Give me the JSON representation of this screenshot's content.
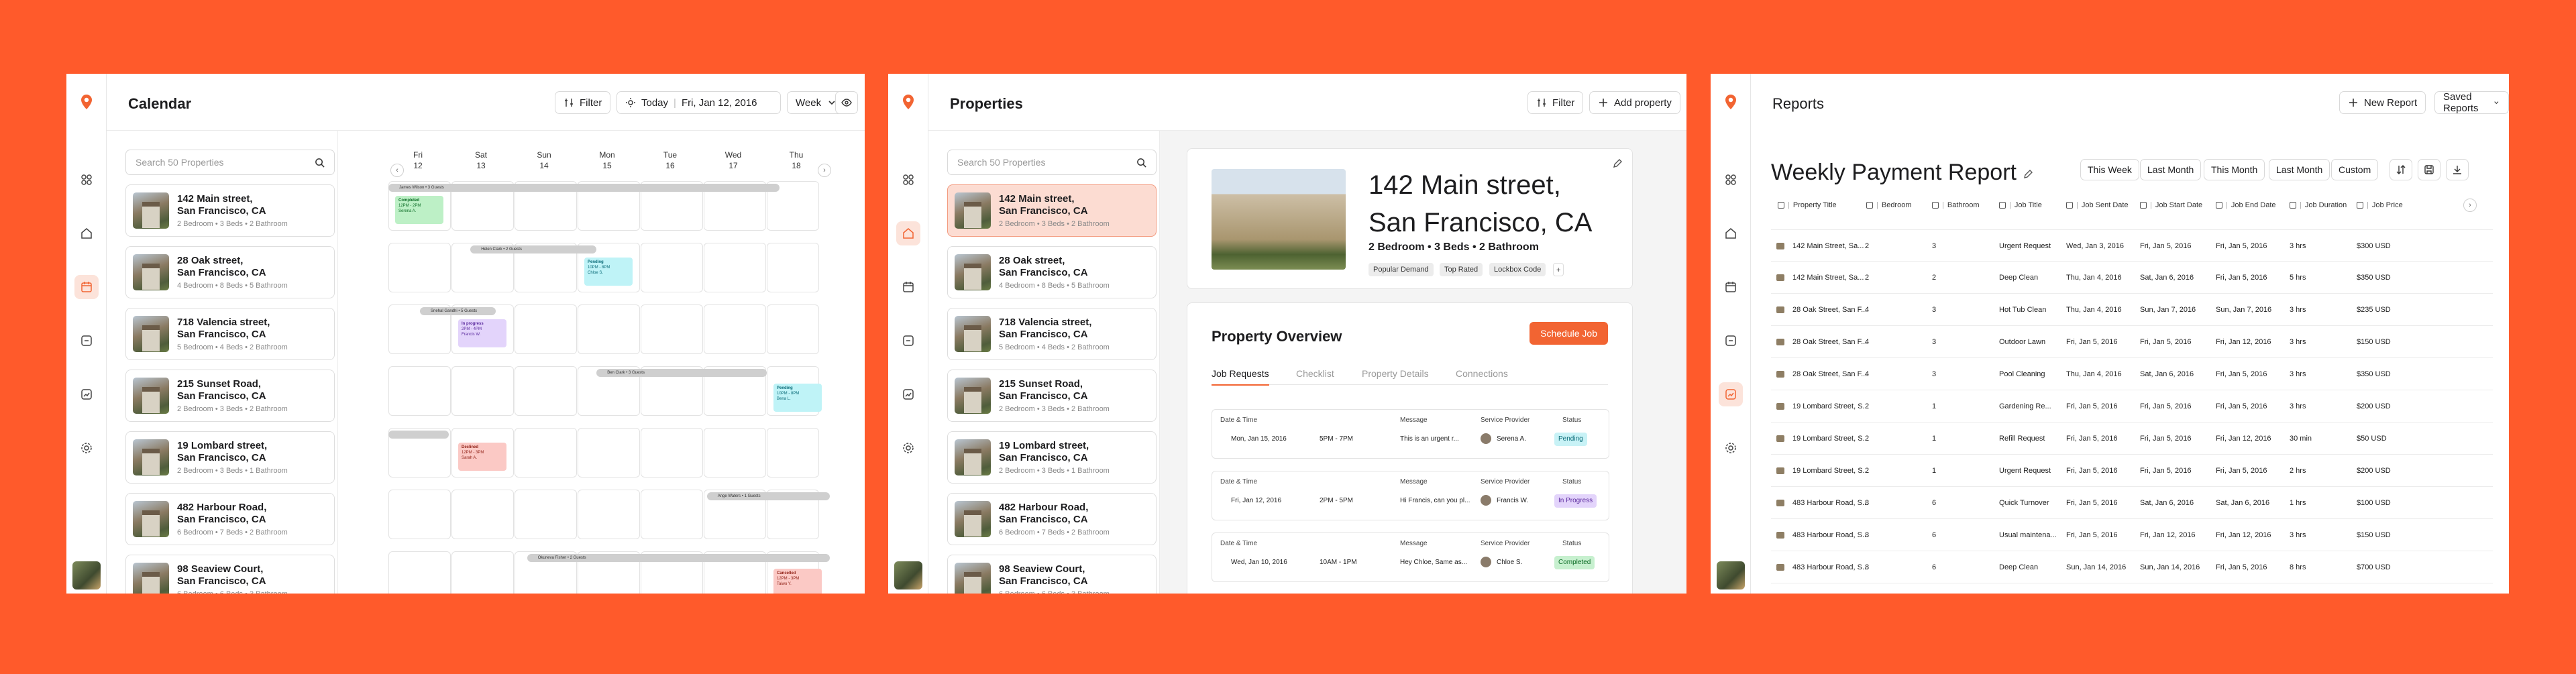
{
  "colors": {
    "background": "#FF5A2B",
    "accent": "#F26432",
    "active_bg": "#FCDCD2"
  },
  "properties": [
    {
      "street": "142 Main street,",
      "city": "San Francisco, CA",
      "meta": "2 Bedroom • 3 Beds • 2 Bathroom"
    },
    {
      "street": "28 Oak street,",
      "city": "San Francisco, CA",
      "meta": "4 Bedroom • 8 Beds • 5 Bathroom"
    },
    {
      "street": "718 Valencia street,",
      "city": "San Francisco, CA",
      "meta": "5 Bedroom • 4 Beds • 2 Bathroom"
    },
    {
      "street": "215 Sunset Road,",
      "city": "San Francisco, CA",
      "meta": "2 Bedroom • 3 Beds • 2 Bathroom"
    },
    {
      "street": "19 Lombard street,",
      "city": "San Francisco, CA",
      "meta": "2 Bedroom • 3 Beds • 1 Bathroom"
    },
    {
      "street": "482 Harbour Road,",
      "city": "San Francisco, CA",
      "meta": "6 Bedroom • 7 Beds • 2 Bathroom"
    },
    {
      "street": "98 Seaview Court,",
      "city": "San Francisco, CA",
      "meta": "6 Bedroom • 6 Beds • 3 Bathroom"
    }
  ],
  "search_placeholder": "Search 50 Properties",
  "calendar": {
    "title": "Calendar",
    "filter": "Filter",
    "today": "Today",
    "date": "Fri, Jan 12, 2016",
    "view": "Week",
    "days": [
      {
        "d": "Fri",
        "n": "12"
      },
      {
        "d": "Sat",
        "n": "13"
      },
      {
        "d": "Sun",
        "n": "14"
      },
      {
        "d": "Mon",
        "n": "15"
      },
      {
        "d": "Tue",
        "n": "16"
      },
      {
        "d": "Wed",
        "n": "17"
      },
      {
        "d": "Thu",
        "n": "18"
      }
    ],
    "bars": [
      "James Wilson • 3 Guests",
      "Helen Clark • 2 Guests",
      "Snehal Gandhi • 5 Guests",
      "Ben Clark • 3 Guests",
      "Ange Waters • 1 Guests",
      "Okuneva Fisher • 2 Guests"
    ],
    "chips": [
      {
        "status": "Completed",
        "time": "12PM - 2PM",
        "who": "Serena A."
      },
      {
        "status": "Pending",
        "time": "10PM - 8PM",
        "who": "Chloe S."
      },
      {
        "status": "In progress",
        "time": "2PM - 4PM",
        "who": "Francis W."
      },
      {
        "status": "Pending",
        "time": "10PM - 8PM",
        "who": "Bena L."
      },
      {
        "status": "Declined",
        "time": "12PM - 3PM",
        "who": "Sarah A."
      },
      {
        "status": "Cancelled",
        "time": "12PM - 3PM",
        "who": "Taiwo Y."
      }
    ]
  },
  "properties_page": {
    "title": "Properties",
    "filter": "Filter",
    "add": "Add property",
    "hero_line1": "142 Main street,",
    "hero_line2": "San Francisco, CA",
    "hero_meta": "2 Bedroom • 3 Beds • 2 Bathroom",
    "tags": [
      "Popular Demand",
      "Top Rated",
      "Lockbox Code"
    ],
    "overview_title": "Property Overview",
    "schedule": "Schedule Job",
    "tabs": [
      "Job Requests",
      "Checklist",
      "Property Details",
      "Connections"
    ],
    "job_labels": {
      "date": "Date & Time",
      "message": "Message",
      "provider": "Service Provider",
      "status": "Status"
    },
    "jobs": [
      {
        "date": "Mon, Jan 15, 2016",
        "time": "5PM - 7PM",
        "msg": "This is an urgent r...",
        "provider": "Serena A.",
        "status": "Pending"
      },
      {
        "date": "Fri, Jan 12, 2016",
        "time": "2PM - 5PM",
        "msg": "Hi Francis, can you pl...",
        "provider": "Francis W.",
        "status": "In Progress"
      },
      {
        "date": "Wed, Jan 10, 2016",
        "time": "10AM - 1PM",
        "msg": "Hey Chloe, Same as...",
        "provider": "Chloe S.",
        "status": "Completed"
      }
    ]
  },
  "reports": {
    "title": "Reports",
    "new": "New Report",
    "saved": "Saved Reports",
    "report_title": "Weekly Payment Report",
    "ranges": [
      "This Week",
      "Last Month",
      "This Month",
      "Last Month",
      "Custom"
    ],
    "columns": [
      "Property Title",
      "Bedroom",
      "Bathroom",
      "Job Title",
      "Job Sent Date",
      "Job Start Date",
      "Job End Date",
      "Job Duration",
      "Job Price"
    ],
    "rows": [
      [
        "142 Main Street, Sa...",
        "2",
        "3",
        "Urgent Request",
        "Wed, Jan 3, 2016",
        "Fri, Jan 5, 2016",
        "Fri, Jan 5, 2016",
        "3 hrs",
        "$300 USD"
      ],
      [
        "142 Main Street, Sa...",
        "2",
        "2",
        "Deep Clean",
        "Thu, Jan 4, 2016",
        "Sat, Jan 6, 2016",
        "Fri, Jan 5, 2016",
        "5 hrs",
        "$350 USD"
      ],
      [
        "28 Oak Street, San F...",
        "4",
        "3",
        "Hot Tub Clean",
        "Thu, Jan 4, 2016",
        "Sun, Jan 7, 2016",
        "Sun, Jan 7, 2016",
        "3 hrs",
        "$235 USD"
      ],
      [
        "28 Oak Street, San F...",
        "4",
        "3",
        "Outdoor Lawn",
        "Fri, Jan 5, 2016",
        "Fri, Jan 5, 2016",
        "Fri, Jan 12, 2016",
        "3 hrs",
        "$150 USD"
      ],
      [
        "28 Oak Street, San F...",
        "4",
        "3",
        "Pool Cleaning",
        "Thu, Jan 4, 2016",
        "Sat, Jan 6, 2016",
        "Fri, Jan 5, 2016",
        "3 hrs",
        "$350 USD"
      ],
      [
        "19 Lombard Street, S...",
        "2",
        "1",
        "Gardening Re...",
        "Fri, Jan 5, 2016",
        "Fri, Jan 5, 2016",
        "Fri, Jan 5, 2016",
        "3 hrs",
        "$200 USD"
      ],
      [
        "19 Lombard Street, S...",
        "2",
        "1",
        "Refill Request",
        "Fri, Jan 5, 2016",
        "Fri, Jan 5, 2016",
        "Fri, Jan 12, 2016",
        "30 min",
        "$50 USD"
      ],
      [
        "19 Lombard Street, S...",
        "2",
        "1",
        "Urgent Request",
        "Fri, Jan 5, 2016",
        "Fri, Jan 5, 2016",
        "Fri, Jan 5, 2016",
        "2 hrs",
        "$200 USD"
      ],
      [
        "483 Harbour Road, S...",
        "8",
        "6",
        "Quick Turnover",
        "Fri, Jan 5, 2016",
        "Sat, Jan 6, 2016",
        "Sat, Jan 6, 2016",
        "1 hrs",
        "$100 USD"
      ],
      [
        "483 Harbour Road, S...",
        "8",
        "6",
        "Usual maintena...",
        "Fri, Jan 5, 2016",
        "Fri, Jan 12, 2016",
        "Fri, Jan 12, 2016",
        "3 hrs",
        "$150 USD"
      ],
      [
        "483 Harbour Road, S...",
        "8",
        "6",
        "Deep Clean",
        "Sun, Jan 14, 2016",
        "Sun, Jan 14, 2016",
        "Fri, Jan 5, 2016",
        "8 hrs",
        "$700 USD"
      ]
    ]
  }
}
